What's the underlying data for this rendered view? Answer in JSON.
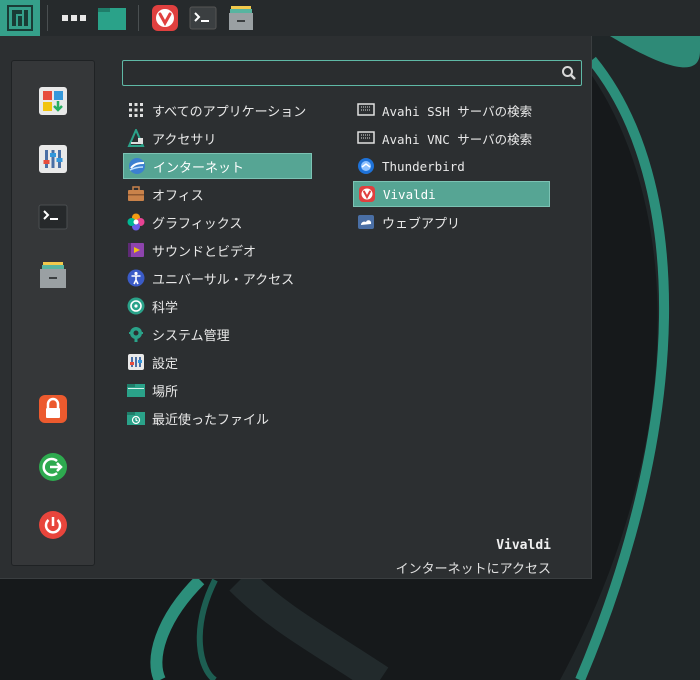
{
  "panel": {
    "launchers": [
      "manjaro-logo-icon",
      "grid-dots-icon",
      "folder-icon",
      "vivaldi-icon",
      "terminal-icon",
      "files-icon"
    ]
  },
  "search": {
    "value": "",
    "placeholder": ""
  },
  "categories": [
    {
      "label": "すべてのアプリケーション",
      "icon": "all-apps-icon"
    },
    {
      "label": "アクセサリ",
      "icon": "accessories-icon"
    },
    {
      "label": "インターネット",
      "icon": "internet-icon",
      "selected": true
    },
    {
      "label": "オフィス",
      "icon": "office-icon"
    },
    {
      "label": "グラフィックス",
      "icon": "graphics-icon"
    },
    {
      "label": "サウンドとビデオ",
      "icon": "multimedia-icon"
    },
    {
      "label": "ユニバーサル・アクセス",
      "icon": "accessibility-icon"
    },
    {
      "label": "科学",
      "icon": "science-icon"
    },
    {
      "label": "システム管理",
      "icon": "system-admin-icon"
    },
    {
      "label": "設定",
      "icon": "settings-icon"
    },
    {
      "label": "場所",
      "icon": "places-icon"
    },
    {
      "label": "最近使ったファイル",
      "icon": "recent-files-icon"
    }
  ],
  "apps": [
    {
      "label": "Avahi SSH サーバの検索",
      "icon": "network-icon"
    },
    {
      "label": "Avahi VNC サーバの検索",
      "icon": "network-icon"
    },
    {
      "label": "Thunderbird",
      "icon": "thunderbird-icon"
    },
    {
      "label": "Vivaldi",
      "icon": "vivaldi-icon",
      "selected": true
    },
    {
      "label": "ウェブアプリ",
      "icon": "web-app-icon"
    }
  ],
  "footer": {
    "app_name": "Vivaldi",
    "app_description": "インターネットにアクセス"
  },
  "sidebar": [
    "software-icon",
    "settings-panel-icon",
    "terminal-icon",
    "files-icon",
    "lock-icon",
    "logout-icon",
    "power-icon"
  ],
  "colors": {
    "accent": "#35a08a",
    "selection": "#56a594"
  }
}
